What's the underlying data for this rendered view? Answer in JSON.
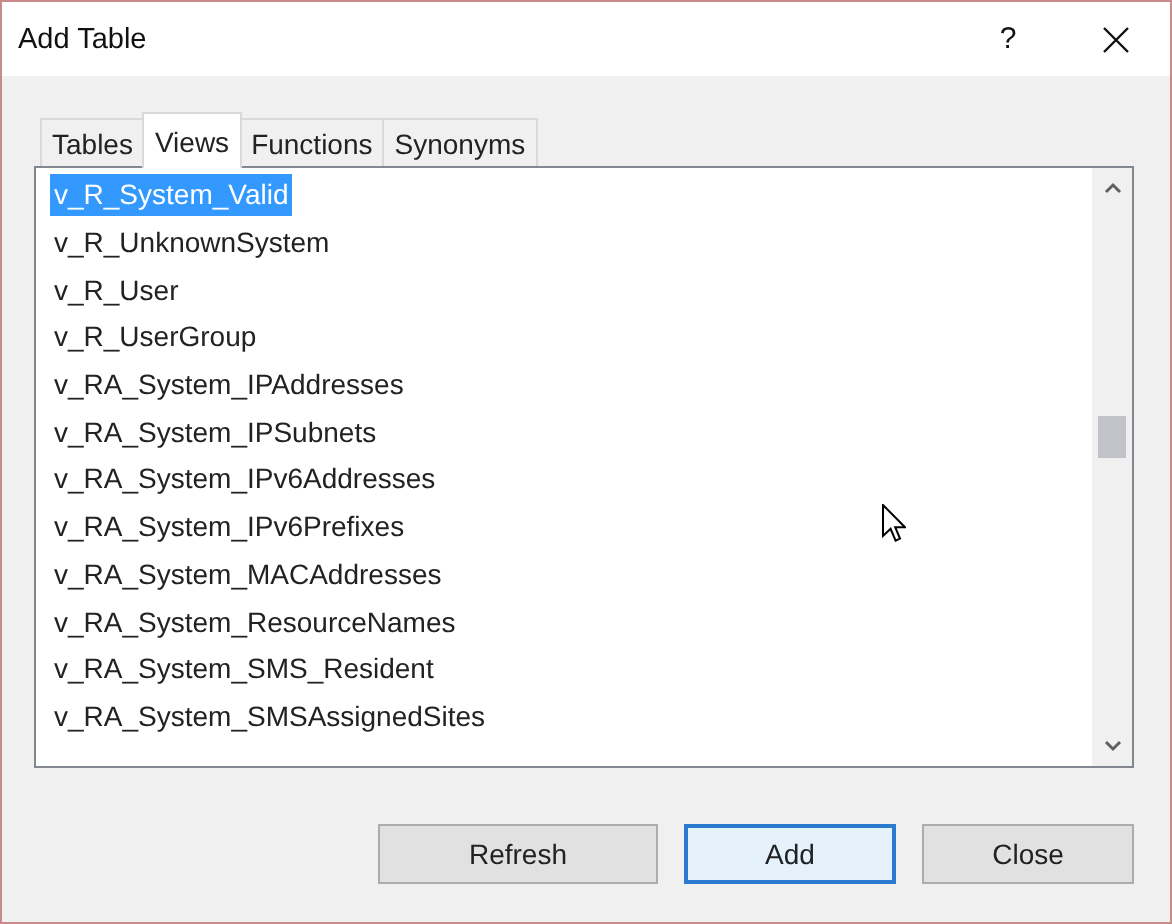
{
  "window": {
    "title": "Add Table"
  },
  "title_bar_buttons": [
    {
      "kind": "help",
      "label": "?"
    },
    {
      "kind": "close"
    }
  ],
  "tabs": [
    {
      "label": "Tables",
      "selected": false
    },
    {
      "label": "Views",
      "selected": true
    },
    {
      "label": "Functions",
      "selected": false
    },
    {
      "label": "Synonyms",
      "selected": false
    }
  ],
  "list": {
    "items": [
      {
        "label": "v_R_System_Valid",
        "selected": true
      },
      {
        "label": "v_R_UnknownSystem",
        "selected": false
      },
      {
        "label": "v_R_User",
        "selected": false
      },
      {
        "label": "v_R_UserGroup",
        "selected": false
      },
      {
        "label": "v_RA_System_IPAddresses",
        "selected": false
      },
      {
        "label": "v_RA_System_IPSubnets",
        "selected": false
      },
      {
        "label": "v_RA_System_IPv6Addresses",
        "selected": false
      },
      {
        "label": "v_RA_System_IPv6Prefixes",
        "selected": false
      },
      {
        "label": "v_RA_System_MACAddresses",
        "selected": false
      },
      {
        "label": "v_RA_System_ResourceNames",
        "selected": false
      },
      {
        "label": "v_RA_System_SMS_Resident",
        "selected": false
      },
      {
        "label": "v_RA_System_SMSAssignedSites",
        "selected": false
      }
    ]
  },
  "buttons": [
    {
      "label": "Refresh",
      "default": false
    },
    {
      "label": "Add",
      "default": true
    },
    {
      "label": "Close",
      "default": false
    }
  ]
}
